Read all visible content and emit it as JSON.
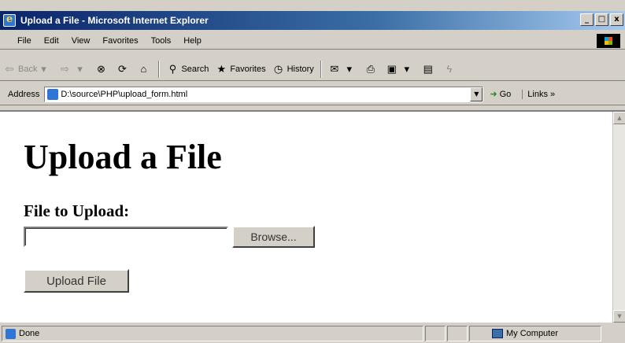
{
  "window": {
    "title": "Upload a File - Microsoft Internet Explorer",
    "min_label": "_",
    "max_label": "□",
    "close_label": "x"
  },
  "menu": {
    "items": [
      "File",
      "Edit",
      "View",
      "Favorites",
      "Tools",
      "Help"
    ]
  },
  "toolbar": {
    "back_label": "Back",
    "search_label": "Search",
    "favorites_label": "Favorites",
    "history_label": "History"
  },
  "address": {
    "label": "Address",
    "value": "D:\\source\\PHP\\upload_form.html",
    "go_label": "Go",
    "links_label": "Links »"
  },
  "page": {
    "heading": "Upload a File",
    "subheading": "File to Upload:",
    "file_value": "",
    "browse_label": "Browse...",
    "submit_label": "Upload File"
  },
  "status": {
    "text": "Done",
    "zone": "My Computer"
  },
  "colors": {
    "title_bar": "#0a246a",
    "chrome": "#d4d0c8"
  }
}
